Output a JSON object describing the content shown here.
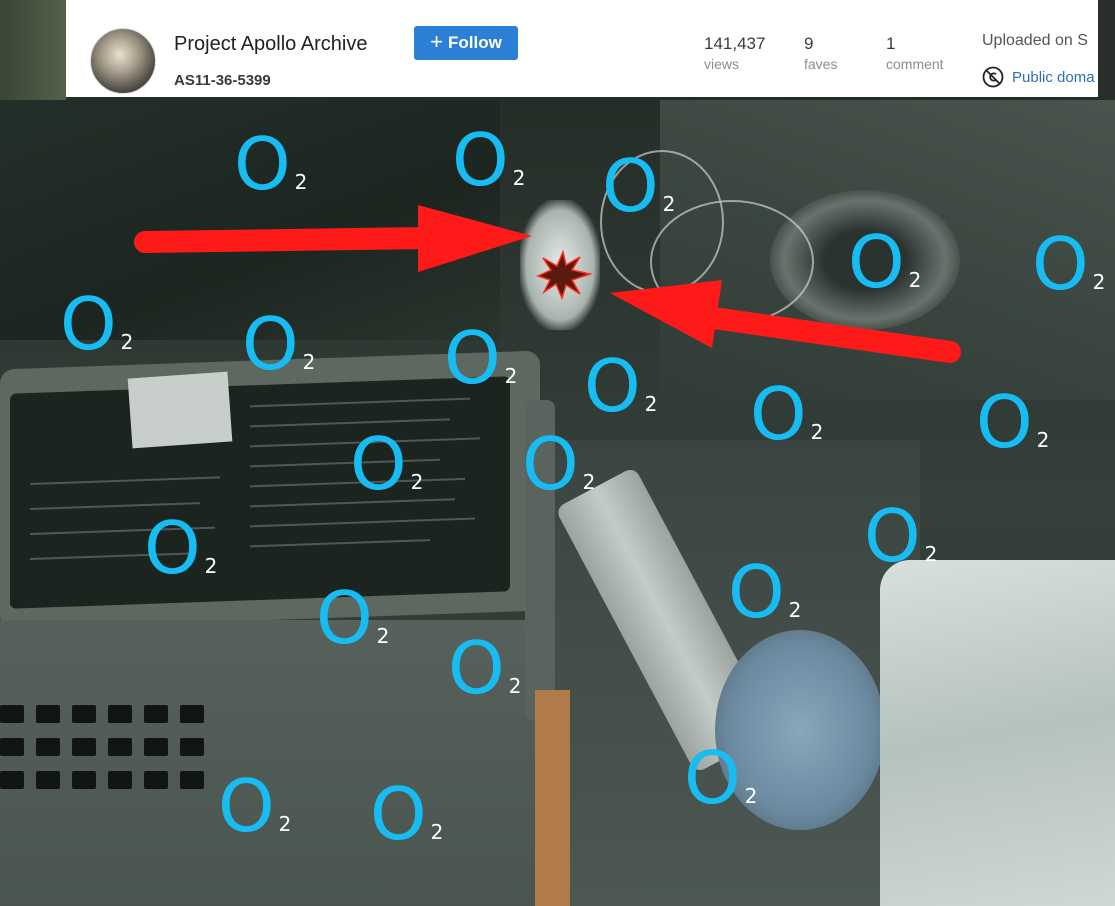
{
  "header": {
    "account_name": "Project Apollo Archive",
    "photo_id": "AS11-36-5399",
    "follow_label": "Follow",
    "follow_icon": "plus-icon",
    "stats": [
      {
        "value": "141,437",
        "label": "views"
      },
      {
        "value": "9",
        "label": "faves"
      },
      {
        "value": "1",
        "label": "comment"
      }
    ],
    "uploaded_text": "Uploaded on S",
    "license_text": "Public doma",
    "license_icon": "public-domain-icon",
    "follow_color": "#2c7fd6"
  },
  "overlay": {
    "label_main": "O",
    "label_sub": "2",
    "label_color": "#14b8f0",
    "arrow_color": "#ff1a1a",
    "marker_icon": "star-burst-icon"
  }
}
